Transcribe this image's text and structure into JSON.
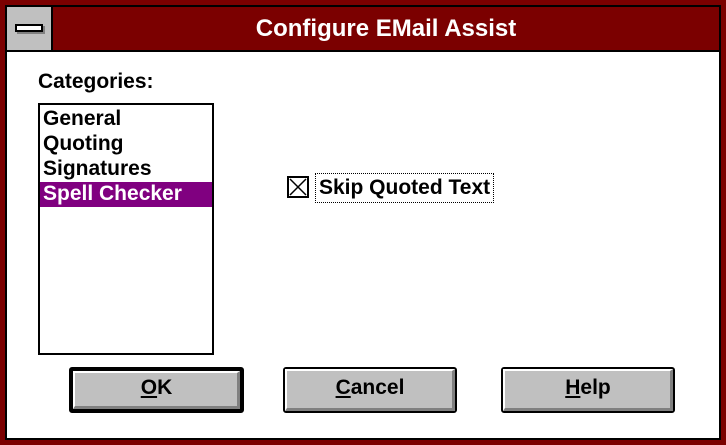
{
  "window": {
    "title": "Configure EMail Assist"
  },
  "categories": {
    "label": "Categories:",
    "items": [
      {
        "label": "General",
        "selected": false
      },
      {
        "label": "Quoting",
        "selected": false
      },
      {
        "label": "Signatures",
        "selected": false
      },
      {
        "label": "Spell Checker",
        "selected": true
      }
    ]
  },
  "options": {
    "skip_quoted_text": {
      "label": "Skip Quoted Text",
      "checked": true
    }
  },
  "buttons": {
    "ok": {
      "mnemonic": "O",
      "rest": "K"
    },
    "cancel": {
      "mnemonic": "C",
      "rest": "ancel"
    },
    "help": {
      "mnemonic": "H",
      "rest": "elp"
    }
  },
  "colors": {
    "title_bar": "#7b0000",
    "selection": "#800080",
    "button_face": "#c0c0c0"
  }
}
